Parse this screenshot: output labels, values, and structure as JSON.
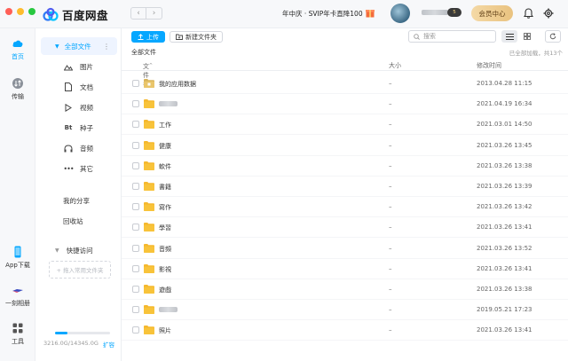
{
  "app": {
    "name": "百度网盘"
  },
  "colors": {
    "accent": "#06a7ff",
    "folder": "#f8c33a",
    "member_gold": "#e9c27f"
  },
  "titlebar": {
    "promo": "年中庆 · SVIP年卡直降100",
    "vip_level": "5",
    "member_center": "会员中心"
  },
  "rail": {
    "home": "首页",
    "transfer": "传输",
    "app_download": "App下载",
    "album": "一刻相册",
    "tools": "工具"
  },
  "sidebar": {
    "all_files": "全部文件",
    "items": [
      {
        "label": "图片",
        "icon": "image-icon"
      },
      {
        "label": "文档",
        "icon": "document-icon"
      },
      {
        "label": "视频",
        "icon": "video-icon"
      },
      {
        "label": "种子",
        "icon": "bt-icon"
      },
      {
        "label": "音频",
        "icon": "headphone-icon"
      },
      {
        "label": "其它",
        "icon": "more-icon"
      }
    ],
    "my_share": "我的分享",
    "recycle": "回收站",
    "quick_access": "快捷访问",
    "quick_add": "+ 拖入常用文件夹",
    "storage": "3216.0G/14345.0G",
    "storage_used_fraction": 0.224,
    "expand": "扩容"
  },
  "toolbar": {
    "upload": "上传",
    "new_folder": "新建文件夹",
    "search_placeholder": "搜索"
  },
  "breadcrumb": "全部文件",
  "loaded_info": "已全部加载，共13个",
  "table": {
    "headers": {
      "name": "文件名",
      "size": "大小",
      "mtime": "修改时间"
    },
    "rows": [
      {
        "name": "我的应用数据",
        "size": "–",
        "mtime": "2013.04.28 11:15",
        "app": true
      },
      {
        "name": "",
        "size": "–",
        "mtime": "2021.04.19 16:34",
        "blurred": true
      },
      {
        "name": "工作",
        "size": "–",
        "mtime": "2021.03.01 14:50"
      },
      {
        "name": "健康",
        "size": "–",
        "mtime": "2021.03.26 13:45"
      },
      {
        "name": "軟件",
        "size": "–",
        "mtime": "2021.03.26 13:38"
      },
      {
        "name": "書籍",
        "size": "–",
        "mtime": "2021.03.26 13:39"
      },
      {
        "name": "寫作",
        "size": "–",
        "mtime": "2021.03.26 13:42"
      },
      {
        "name": "學習",
        "size": "–",
        "mtime": "2021.03.26 13:41"
      },
      {
        "name": "音頻",
        "size": "–",
        "mtime": "2021.03.26 13:52"
      },
      {
        "name": "影視",
        "size": "–",
        "mtime": "2021.03.26 13:41"
      },
      {
        "name": "遊戲",
        "size": "–",
        "mtime": "2021.03.26 13:38"
      },
      {
        "name": "",
        "size": "–",
        "mtime": "2019.05.21 17:23",
        "blurred": true
      },
      {
        "name": "照片",
        "size": "–",
        "mtime": "2021.03.26 13:41"
      }
    ]
  }
}
